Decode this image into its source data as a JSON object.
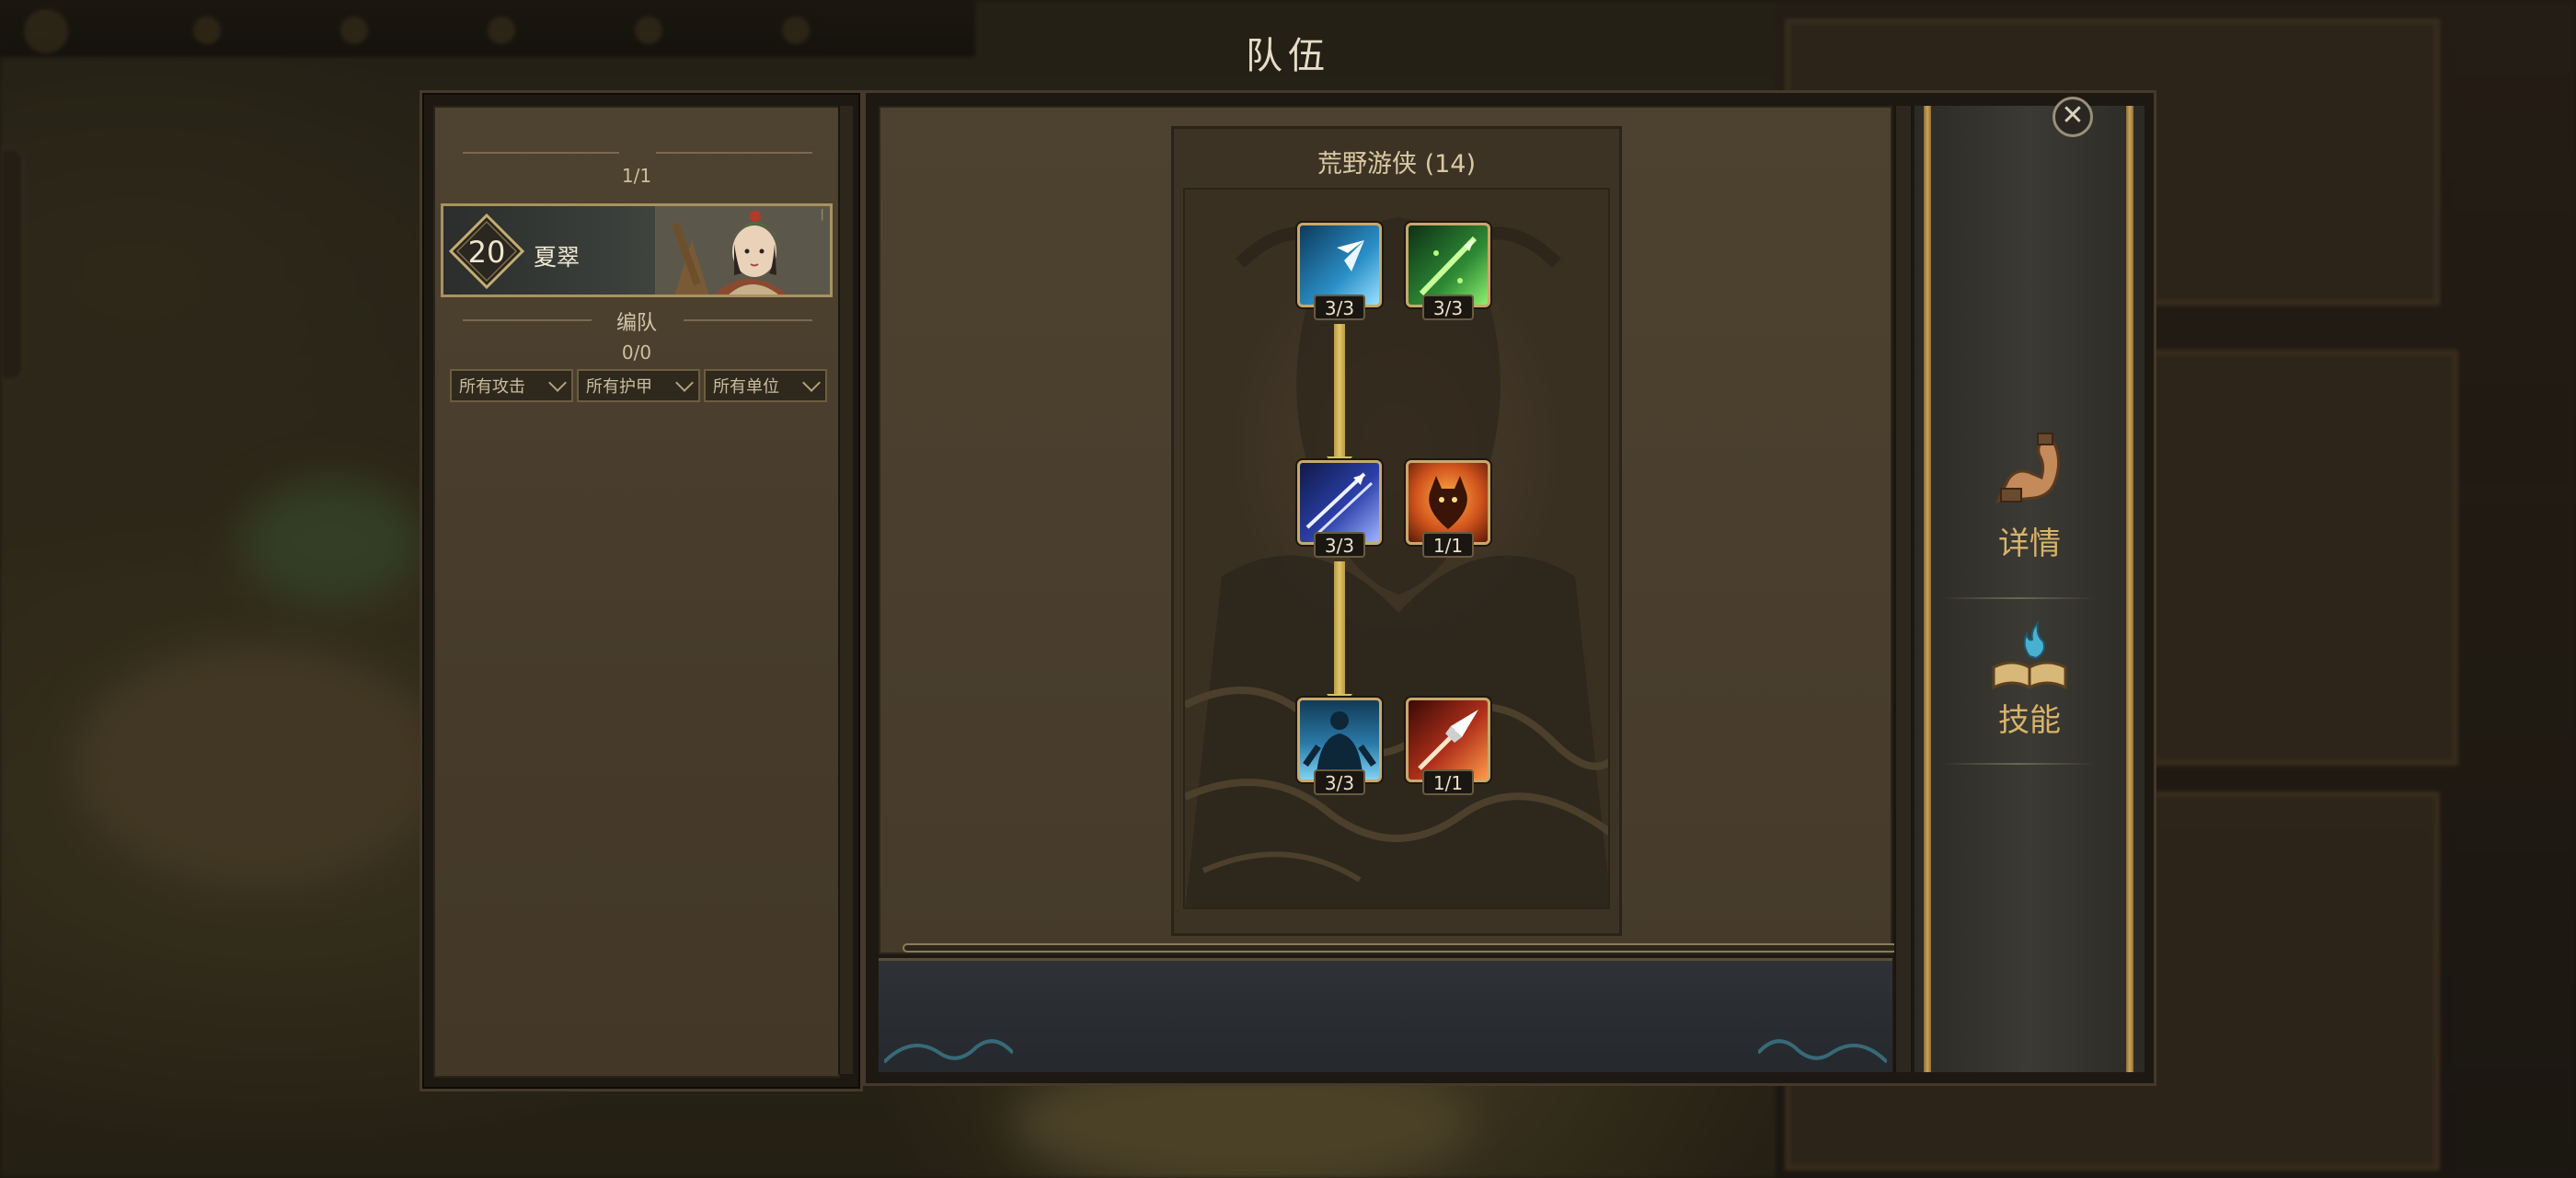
{
  "header": {
    "title": "队伍"
  },
  "roster": {
    "hero_count": "1/1",
    "hero": {
      "level": "20",
      "name": "夏翠"
    },
    "formation_label": "编队",
    "formation_count": "0/0",
    "filters": [
      {
        "label": "所有攻击"
      },
      {
        "label": "所有护甲"
      },
      {
        "label": "所有单位"
      }
    ]
  },
  "skill_tree": {
    "title": "荒野游侠 (14)",
    "skills": [
      {
        "icon": "arrow-strike-icon",
        "rank": "3/3"
      },
      {
        "icon": "poison-spear-icon",
        "rank": "3/3"
      },
      {
        "icon": "piercing-arrows-icon",
        "rank": "3/3"
      },
      {
        "icon": "fire-beast-icon",
        "rank": "1/1"
      },
      {
        "icon": "spirit-body-icon",
        "rank": "3/3"
      },
      {
        "icon": "flaming-arrowhead-icon",
        "rank": "1/1"
      }
    ]
  },
  "tabs": [
    {
      "label": "详情",
      "icon": "flexed-arm-icon"
    },
    {
      "label": "技能",
      "icon": "spell-book-icon"
    }
  ],
  "colors": {
    "accent_gold": "#d9b36a",
    "frame": "#c9a86a"
  }
}
